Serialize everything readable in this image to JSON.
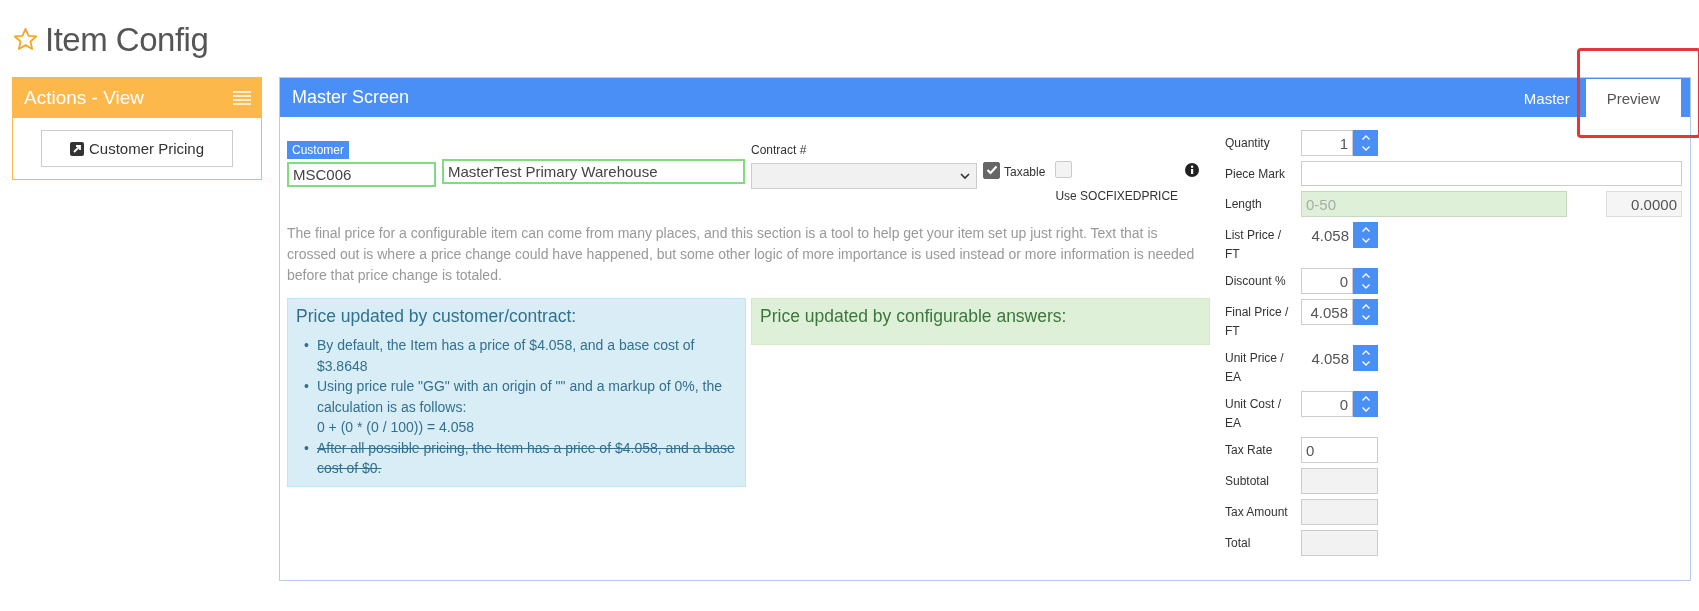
{
  "page_title": "Item Config",
  "sidebar": {
    "title": "Actions - View",
    "actions": [
      {
        "label": "Customer Pricing"
      }
    ]
  },
  "main": {
    "title": "Master Screen",
    "tabs": [
      {
        "label": "Master",
        "selected": false,
        "highlighted": false
      },
      {
        "label": "Preview",
        "selected": true,
        "highlighted": true
      }
    ],
    "customer": {
      "label": "Customer",
      "code": "MSC006",
      "name": "MasterTest Primary Warehouse"
    },
    "contract": {
      "label": "Contract #"
    },
    "taxable": {
      "label": "Taxable",
      "checked": true
    },
    "fixed_price": {
      "label": "Use SOCFIXEDPRICE",
      "checked": false
    },
    "description": "The final price for a configurable item can come from many places, and this section is a tool to help get your item set up just right. Text that is crossed out is where a price change could have happened, but some other logic of more importance is used instead or more information is needed before that price change is totaled.",
    "notes": [
      {
        "kind": "info",
        "title": "Price updated by customer/contract:",
        "items": [
          {
            "bullet": "•",
            "text": "By default, the Item has a price of $4.058, and a base cost of $3.8648",
            "struck": false
          },
          {
            "bullet": "•",
            "text": "Using price rule \"GG\" with an origin of \"\" and a markup of 0%, the calculation is as follows:\n0 + (0 * (0 / 100)) = 4.058",
            "struck": false
          },
          {
            "bullet": "•",
            "text": "After all possible pricing, the Item has a price of $4.058, and a base cost of $0.",
            "struck": true
          }
        ]
      },
      {
        "kind": "success",
        "title": "Price updated by configurable answers:"
      }
    ],
    "fields": [
      {
        "kind": "spinner",
        "label": "Quantity",
        "value": "1"
      },
      {
        "kind": "text",
        "label": "Piece Mark"
      },
      {
        "kind": "range",
        "label": "Length",
        "placeholder": "0-50",
        "value": "0.0000"
      },
      {
        "kind": "plain-spinner",
        "label": "List Price / FT",
        "value": "4.058"
      },
      {
        "kind": "spinner",
        "label": "Discount %",
        "value": "0"
      },
      {
        "kind": "spinner",
        "label": "Final Price / FT",
        "value": "4.058"
      },
      {
        "kind": "plain-spinner",
        "label": "Unit Price / EA",
        "value": "4.058"
      },
      {
        "kind": "spinner",
        "label": "Unit Cost / EA",
        "value": "0"
      },
      {
        "kind": "short-text",
        "label": "Tax Rate",
        "value": "0"
      },
      {
        "kind": "readonly",
        "label": "Subtotal"
      },
      {
        "kind": "readonly",
        "label": "Tax Amount"
      },
      {
        "kind": "readonly",
        "label": "Total"
      }
    ]
  }
}
